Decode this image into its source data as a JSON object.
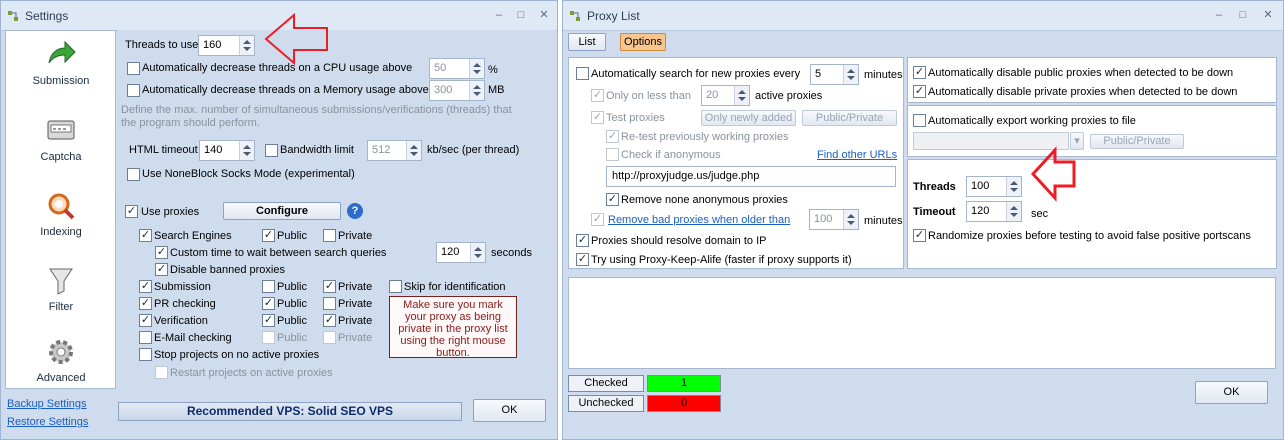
{
  "settings": {
    "title": "Settings",
    "nav": [
      {
        "label": "Submission",
        "icon": "arrow-icon"
      },
      {
        "label": "Captcha",
        "icon": "captcha-icon"
      },
      {
        "label": "Indexing",
        "icon": "indexing-icon"
      },
      {
        "label": "Filter",
        "icon": "filter-icon"
      },
      {
        "label": "Advanced",
        "icon": "gear-icon"
      }
    ],
    "backup_link": "Backup Settings",
    "restore_link": "Restore Settings",
    "threads_label": "Threads to use",
    "threads_value": "160",
    "cpu_label": "Automatically decrease threads on a CPU usage above",
    "cpu_value": "50",
    "cpu_unit": "%",
    "mem_label": "Automatically decrease threads on a Memory usage above",
    "mem_value": "300",
    "mem_unit": "MB",
    "desc": "Define the max. number of simultaneous submissions/verifications (threads) that the program should perform.",
    "html_timeout_label": "HTML timeout",
    "html_timeout_value": "140",
    "bandwidth_label": "Bandwidth limit",
    "bandwidth_value": "512",
    "bandwidth_unit": "kb/sec (per thread)",
    "noneblock_label": "Use NoneBlock Socks Mode (experimental)",
    "use_proxies_label": "Use proxies",
    "configure_label": "Configure",
    "help_glyph": "?",
    "search_engines_label": "Search Engines",
    "public_label": "Public",
    "private_label": "Private",
    "custom_time_label": "Custom time to wait between search queries",
    "custom_time_value": "120",
    "seconds_label": "seconds",
    "disable_banned_label": "Disable banned proxies",
    "submission_label": "Submission",
    "pr_checking_label": "PR checking",
    "verification_label": "Verification",
    "email_checking_label": "E-Mail checking",
    "skip_label": "Skip for identification",
    "note": "Make sure you mark your proxy as being private in the proxy list using the right mouse button.",
    "stop_label": "Stop projects on no active proxies",
    "restart_label": "Restart projects on active proxies",
    "vps_label": "Recommended VPS: Solid SEO VPS",
    "ok_label": "OK"
  },
  "proxy": {
    "title": "Proxy List",
    "tab_list": "List",
    "tab_options": "Options",
    "auto_search_label": "Automatically search for new proxies every",
    "auto_search_value": "5",
    "minutes_label": "minutes",
    "only_less_label": "Only on less than",
    "only_less_value": "20",
    "active_proxies_label": "active proxies",
    "test_proxies_label": "Test proxies",
    "only_newly_label": "Only newly added",
    "public_private_label": "Public/Private",
    "retest_label": "Re-test previously working proxies",
    "check_anon_label": "Check if anonymous",
    "find_urls_link": "Find other URLs",
    "judge_url": "http://proxyjudge.us/judge.php",
    "remove_none_label": "Remove none anonymous proxies",
    "remove_bad_label": "Remove bad proxies when older than",
    "remove_bad_value": "100",
    "resolve_label": "Proxies should resolve domain to IP",
    "keepalive_label": "Try using Proxy-Keep-Alife (faster if proxy supports it)",
    "disable_public_label": "Automatically disable public proxies when detected to be down",
    "disable_private_label": "Automatically disable private proxies when detected to be down",
    "export_label": "Automatically export working proxies to file",
    "export_pp_label": "Public/Private",
    "threads_label": "Threads",
    "threads_value": "100",
    "timeout_label": "Timeout",
    "timeout_value": "120",
    "sec_label": "sec",
    "randomize_label": "Randomize proxies before testing to avoid false positive portscans",
    "checked_label": "Checked",
    "checked_value": "1",
    "unchecked_label": "Unchecked",
    "unchecked_value": "0",
    "ok_label": "OK"
  },
  "colors": {
    "arrow": "#ee1c24",
    "checked": "#00ff00",
    "unchecked": "#ff0000",
    "accent": "#f7c58d"
  }
}
